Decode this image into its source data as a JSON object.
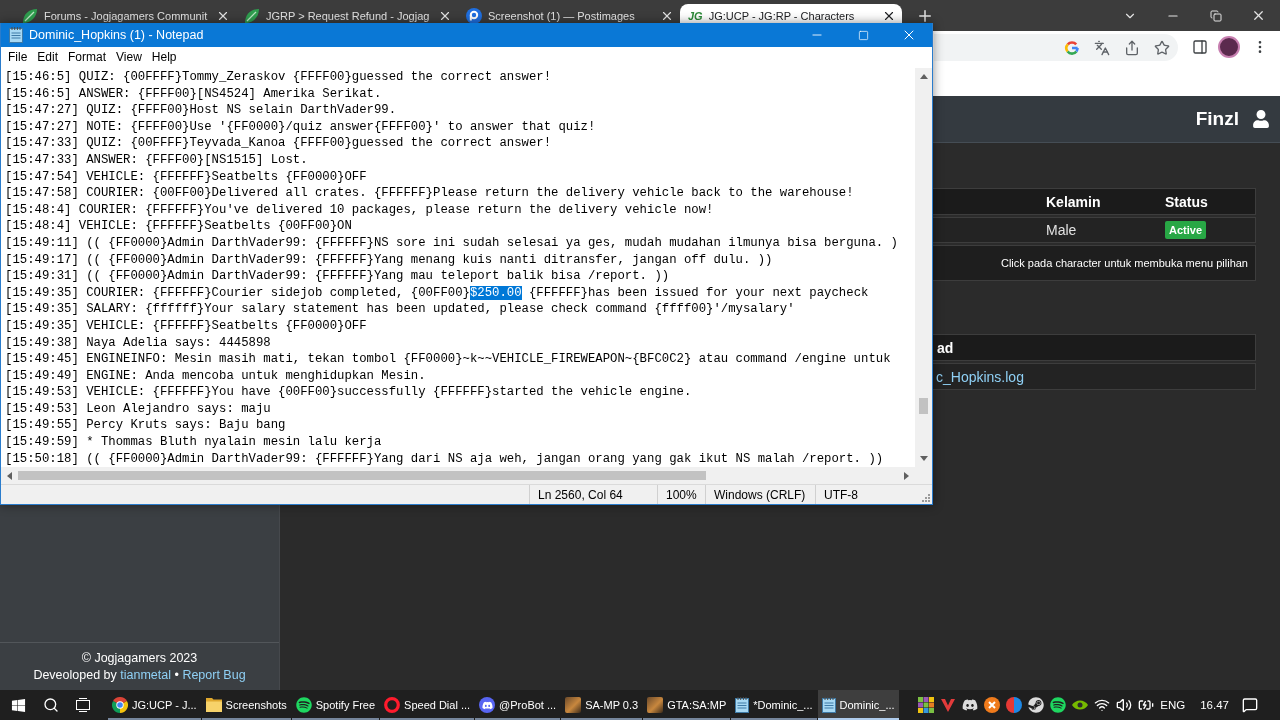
{
  "browser": {
    "tabs": [
      {
        "title": "Forums - Jogjagamers Communit",
        "kind": "leaf",
        "selected": false
      },
      {
        "title": "JGRP > Request Refund - Jogjag",
        "kind": "leaf",
        "selected": false
      },
      {
        "title": "Screenshot (1) — Postimages",
        "kind": "ring",
        "selected": false
      },
      {
        "title": "JG:UCP - JG:RP - Characters",
        "kind": "text",
        "logo_text": "JG",
        "selected": true
      }
    ],
    "navbar": {
      "user_name": "Finzl"
    },
    "sidebar_footer": {
      "copyright": "© Jogjagamers 2023",
      "credit_prefix": "Deveoloped by",
      "author_link": "tianmetal",
      "separator": "•",
      "report_link": "Report Bug"
    },
    "characters_table": {
      "columns": [
        "Kelamin",
        "Status"
      ],
      "rows": [
        {
          "kelamin": "Male",
          "status": {
            "label": "Active",
            "color": "#28a745"
          }
        }
      ],
      "hint": "Click pada character untuk membuka menu pilihan"
    },
    "logs_table": {
      "columns": [
        "ad"
      ],
      "rows": [
        {
          "file": "c_Hopkins.log"
        }
      ]
    }
  },
  "notepad": {
    "title": "Dominic_Hopkins (1) - Notepad",
    "menu": [
      "File",
      "Edit",
      "Format",
      "View",
      "Help"
    ],
    "lines": [
      {
        "text": "[15:46:5] QUIZ: {00FFFF}Tommy_Zeraskov {FFFF00}guessed the correct answer!"
      },
      {
        "text": "[15:46:5] ANSWER: {FFFF00}[NS4524] Amerika Serikat."
      },
      {
        "text": "[15:47:27] QUIZ: {FFFF00}Host NS selain DarthVader99."
      },
      {
        "text": "[15:47:27] NOTE: {FFFF00}Use '{FF0000}/quiz answer{FFFF00}' to answer that quiz!"
      },
      {
        "text": "[15:47:33] QUIZ: {00FFFF}Teyvada_Kanoa {FFFF00}guessed the correct answer!"
      },
      {
        "text": "[15:47:33] ANSWER: {FFFF00}[NS1515] Lost."
      },
      {
        "text": "[15:47:54] VEHICLE: {FFFFFF}Seatbelts {FF0000}OFF"
      },
      {
        "text": "[15:47:58] COURIER: {00FF00}Delivered all crates. {FFFFFF}Please return the delivery vehicle back to the warehouse!"
      },
      {
        "text": "[15:48:4] COURIER: {FFFFFF}You've delivered 10 packages, please return the delivery vehicle now!"
      },
      {
        "text": "[15:48:4] VEHICLE: {FFFFFF}Seatbelts {00FF00}ON"
      },
      {
        "text": "[15:49:11] (( {FF0000}Admin DarthVader99: {FFFFFF}NS sore ini sudah selesai ya ges, mudah mudahan ilmunya bisa berguna. )"
      },
      {
        "text": "[15:49:17] (( {FF0000}Admin DarthVader99: {FFFFFF}Yang menang kuis nanti ditransfer, jangan off dulu. ))"
      },
      {
        "text": "[15:49:31] (( {FF0000}Admin DarthVader99: {FFFFFF}Yang mau teleport balik bisa /report. ))"
      },
      {
        "segments": [
          {
            "text": "[15:49:35] COURIER: {FFFFFF}Courier sidejob completed, {00FF00}",
            "selected": false
          },
          {
            "text": "$250.00",
            "selected": true
          },
          {
            "text": " {FFFFFF}has been issued for your next paycheck",
            "selected": false
          }
        ]
      },
      {
        "text": "[15:49:35] SALARY: {ffffff}Your salary statement has been updated, please check command {ffff00}'/mysalary'"
      },
      {
        "text": "[15:49:35] VEHICLE: {FFFFFF}Seatbelts {FF0000}OFF"
      },
      {
        "text": "[15:49:38] Naya Adelia says: 4445898"
      },
      {
        "text": "[15:49:45] ENGINEINFO: Mesin masih mati, tekan tombol {FF0000}~k~~VEHICLE_FIREWEAPON~{BFC0C2} atau command /engine untuk"
      },
      {
        "text": "[15:49:49] ENGINE: Anda mencoba untuk menghidupkan Mesin."
      },
      {
        "text": "[15:49:53] VEHICLE: {FFFFFF}You have {00FF00}successfully {FFFFFF}started the vehicle engine."
      },
      {
        "text": "[15:49:53] Leon Alejandro says: maju"
      },
      {
        "text": "[15:49:55] Percy Kruts says: Baju bang"
      },
      {
        "text": "[15:49:59] * Thommas Bluth nyalain mesin lalu kerja"
      },
      {
        "text": "[15:50:18] (( {FF0000}Admin DarthVader99: {FFFFFF}Yang dari NS aja weh, jangan orang yang gak ikut NS malah /report. ))"
      }
    ],
    "status_bar": {
      "position": "Ln 2560, Col 64",
      "zoom": "100%",
      "line_ending": "Windows (CRLF)",
      "encoding": "UTF-8"
    }
  },
  "taskbar": {
    "apps": [
      {
        "label": "JG:UCP - J...",
        "kind": "browser",
        "selected": false
      },
      {
        "label": "Screenshots",
        "kind": "folder",
        "selected": false
      },
      {
        "label": "Spotify Free",
        "kind": "music",
        "selected": false
      },
      {
        "label": "Speed Dial ...",
        "kind": "ring",
        "selected": false
      },
      {
        "label": "@ProBot ...",
        "kind": "chat",
        "selected": false
      },
      {
        "label": "SA-MP 0.3",
        "kind": "game",
        "selected": false
      },
      {
        "label": "GTA:SA:MP",
        "kind": "game",
        "selected": false
      },
      {
        "label": "*Dominic_...",
        "kind": "editor",
        "selected": false
      },
      {
        "label": "Dominic_...",
        "kind": "editor",
        "selected": true
      }
    ],
    "language": "ENG",
    "clock": "16.47"
  }
}
